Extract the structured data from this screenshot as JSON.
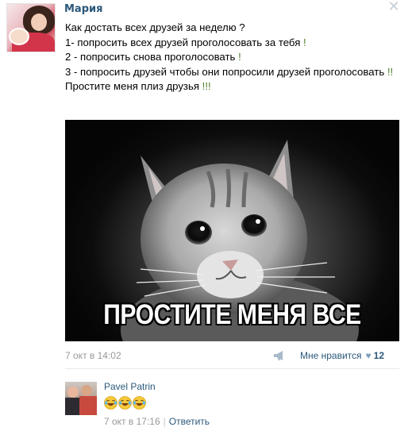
{
  "post": {
    "author": "Мария",
    "lines": [
      "Как достать всех друзей за неделю ?",
      "1- попросить всех друзей проголосовать за тебя",
      "2 - попросить снова проголосовать",
      "3 - попросить друзей чтобы они попросили друзей проголосовать",
      "Простите меня плиз друзья"
    ],
    "exclamations": [
      "!",
      "!",
      "!!",
      "!!!"
    ],
    "image_caption": "ПРОСТИТЕ МЕНЯ ВСЕ",
    "timestamp": "7 окт в 14:02",
    "like_label": "Мне нравится",
    "like_count": "12"
  },
  "comment": {
    "author": "Pavel Patrin",
    "emoji_count": 3,
    "emoji_icon": "laughing-with-tears-icon",
    "timestamp": "7 окт в 17:16",
    "separator": "|",
    "reply_label": "Ответить"
  },
  "icons": {
    "close": "close-icon",
    "device": "apple-icon",
    "share": "megaphone-icon",
    "like": "heart-icon"
  },
  "colors": {
    "link": "#2b587a",
    "meta": "#999999",
    "exclamation": "#4e7f2a",
    "heart": "#7c9fbe"
  }
}
